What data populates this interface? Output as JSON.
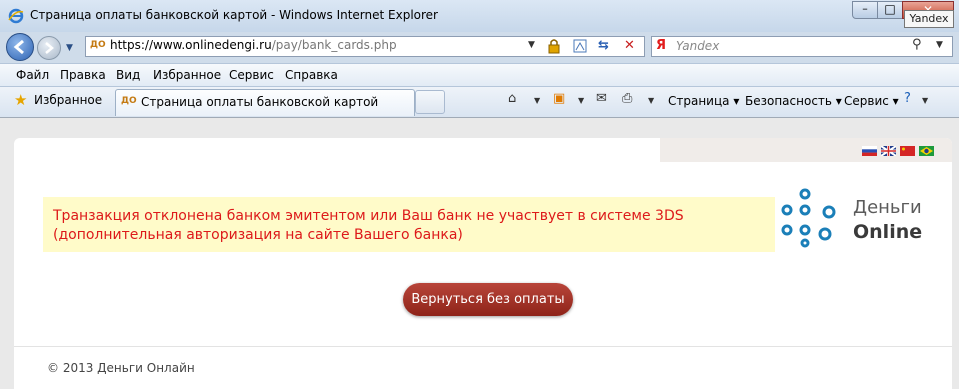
{
  "window": {
    "title": "Страница оплаты банковской картой - Windows Internet Explorer",
    "min_label": "–",
    "max_label": "□",
    "close_label": "✕",
    "tooltip": "Yandex"
  },
  "address_bar": {
    "url_prefix": "https://www.onlinedengi.ru",
    "url_path": "/pay/bank_cards.php",
    "favicon": "ДО"
  },
  "search": {
    "engine_logo": "Я",
    "placeholder": "Yandex"
  },
  "menu": [
    "Файл",
    "Правка",
    "Вид",
    "Избранное",
    "Сервис",
    "Справка"
  ],
  "favorites": {
    "label": "Избранное",
    "tab_title": "Страница оплаты банковской картой"
  },
  "command_bar": {
    "page": "Страница",
    "safety": "Безопасность",
    "tools": "Сервис"
  },
  "page": {
    "error_message": "Транзакция отклонена банком эмитентом или Ваш банк не участвует в системе 3DS (дополнительная авторизация на сайте Вашего банка)",
    "logo_line1": "Деньги",
    "logo_line2": "Online",
    "return_button": "Вернуться без оплаты",
    "copyright": "© 2013 Деньги Онлайн",
    "languages": [
      "ru",
      "en",
      "cn",
      "br"
    ]
  },
  "colors": {
    "error_text": "#dd1a1a",
    "alert_bg": "#fffbc9",
    "button_bg": "#a3342a",
    "logo_blue": "#1b7fb8"
  }
}
